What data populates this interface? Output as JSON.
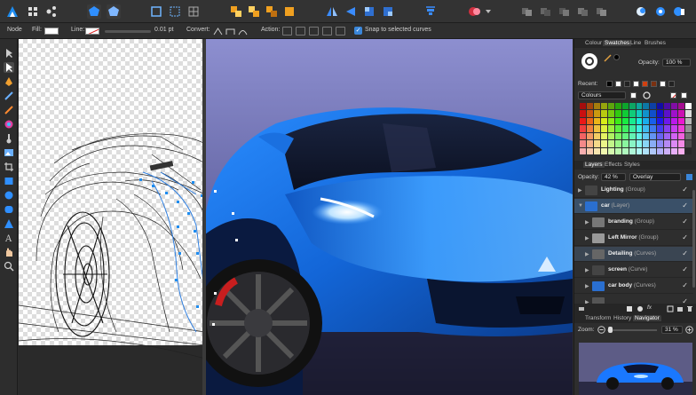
{
  "context_bar": {
    "mode": "Node",
    "fill_label": "Fill:",
    "line_label": "Line:",
    "line_width": "0.01 pt",
    "convert_label": "Convert:",
    "action_label": "Action:",
    "snap_label": "Snap to selected curves"
  },
  "panel": {
    "top_tabs": [
      "Colour",
      "Swatches",
      "Line",
      "Brushes"
    ],
    "opacity_label": "Opacity:",
    "opacity_value": "100 %",
    "recent_label": "Recent:",
    "palette_name": "Colours",
    "layer_tabs": [
      "Layers",
      "Effects",
      "Styles"
    ],
    "layer_opacity_label": "Opacity:",
    "layer_opacity_value": "42 %",
    "blend_mode": "Overlay",
    "layers": [
      {
        "name": "Lighting",
        "type": "(Group)"
      },
      {
        "name": "car",
        "type": "(Layer)"
      },
      {
        "name": "branding",
        "type": "(Group)"
      },
      {
        "name": "Left Mirror",
        "type": "(Group)"
      },
      {
        "name": "Detailing",
        "type": "(Curves)"
      },
      {
        "name": "screen",
        "type": "(Curve)"
      },
      {
        "name": "car body",
        "type": "(Curves)"
      },
      {
        "name": "",
        "type": ""
      }
    ],
    "fx_label": "fx",
    "bottom_tabs": [
      "Transform",
      "History",
      "Navigator"
    ],
    "zoom_label": "Zoom:",
    "zoom_value": "31 %"
  },
  "colors": {
    "accent_blue": "#2f8fff",
    "selection": "#3a5068",
    "car_blue": "#1a7bff"
  }
}
